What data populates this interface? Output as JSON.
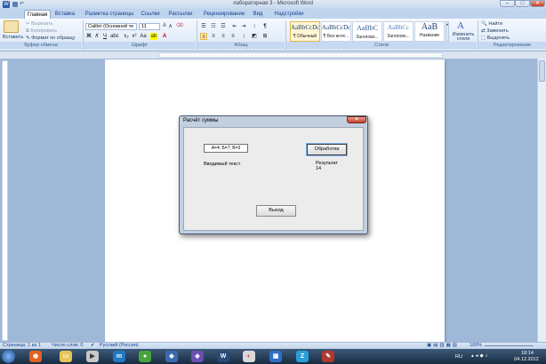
{
  "window": {
    "title": "лабораторная 3 - Microsoft Word",
    "minimize": "–",
    "maximize": "□",
    "close": "✕"
  },
  "ribbon_tabs": [
    "Главная",
    "Вставка",
    "Разметка страницы",
    "Ссылки",
    "Рассылки",
    "Рецензирование",
    "Вид",
    "Надстройки"
  ],
  "clipboard": {
    "paste": "Вставить",
    "cut": "Вырезать",
    "copy": "Копировать",
    "format_painter": "Формат по образцу",
    "label": "Буфер обмена"
  },
  "font": {
    "name": "Calibri (Основной те",
    "size": "11",
    "label": "Шрифт",
    "bold": "Ж",
    "italic": "К",
    "underline": "Ч"
  },
  "paragraph": {
    "label": "Абзац"
  },
  "styles": {
    "label": "Стили",
    "items": [
      {
        "preview": "AaBbCcDc",
        "name": "¶ Обычный"
      },
      {
        "preview": "AaBbCcDc",
        "name": "¶ Без инте..."
      },
      {
        "preview": "AaBbC",
        "name": "Заголово..."
      },
      {
        "preview": "AaBbCc",
        "name": "Заголово..."
      },
      {
        "preview": "AaB",
        "name": "Название"
      }
    ],
    "change_styles": "Изменить стили"
  },
  "editing": {
    "label": "Редактирование",
    "find": "Найти",
    "replace": "Заменить",
    "select": "Выделить"
  },
  "dialog": {
    "title": "Расчёт суммы",
    "close": "✕",
    "input_value": "A=4; Б=7; B=3",
    "process_button": "Обработка",
    "input_label": "Вводимый текст",
    "result_label": "Результат",
    "result_value": "14",
    "exit_button": "Выход"
  },
  "status": {
    "page": "Страница: 1 из 1",
    "words": "Число слов: 0",
    "language": "Русский (Россия)",
    "zoom": "100%"
  },
  "tray": {
    "lang": "RU",
    "time": "18:14",
    "date": "04.12.2012"
  },
  "colors": {
    "ribbon_tab_bg": "#bfd4ee",
    "dialog_frame": "#c2cfe0",
    "taskbar": "#182b40",
    "doc_bg": "#9fb8d8"
  }
}
